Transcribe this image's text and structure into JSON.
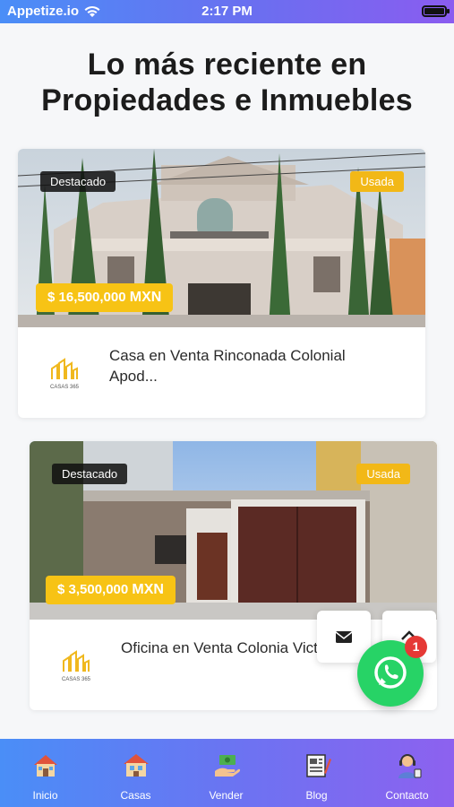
{
  "status_bar": {
    "carrier": "Appetize.io",
    "time": "2:17 PM"
  },
  "headline": {
    "line1": "Lo más reciente en",
    "line2": "Propiedades e Inmuebles"
  },
  "listings": [
    {
      "featured_label": "Destacado",
      "condition_label": "Usada",
      "price": "$ 16,500,000",
      "currency": "MXN",
      "title_line1": "Casa en Venta Rinconada Colonial",
      "title_line2": "Apod...",
      "logo_text": "CASAS 365"
    },
    {
      "featured_label": "Destacado",
      "condition_label": "Usada",
      "price": "$ 3,500,000",
      "currency": "MXN",
      "title_line1": "Oficina en Venta Colonia Victoria M...",
      "logo_text": "CASAS 365"
    }
  ],
  "notification_count": "1",
  "bottom_nav": [
    {
      "label": "Inicio",
      "icon": "house-icon"
    },
    {
      "label": "Casas",
      "icon": "houses-icon"
    },
    {
      "label": "Vender",
      "icon": "money-hand-icon"
    },
    {
      "label": "Blog",
      "icon": "newspaper-icon"
    },
    {
      "label": "Contacto",
      "icon": "contact-support-icon"
    }
  ],
  "colors": {
    "accent_gradient_start": "#4a8ef7",
    "accent_gradient_end": "#8d61ef",
    "price_badge": "#f7c315",
    "used_badge": "#f2b817",
    "whatsapp": "#27d366"
  }
}
